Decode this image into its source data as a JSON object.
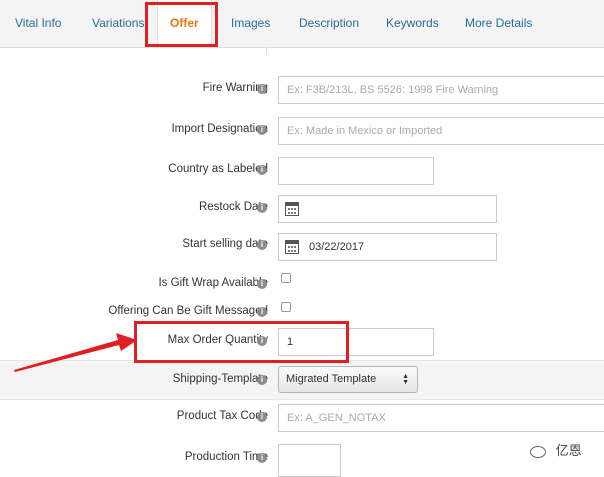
{
  "tabs": [
    {
      "label": "Vital Info"
    },
    {
      "label": "Variations"
    },
    {
      "label": "Offer"
    },
    {
      "label": "Images"
    },
    {
      "label": "Description"
    },
    {
      "label": "Keywords"
    },
    {
      "label": "More Details"
    }
  ],
  "active_tab": "Offer",
  "accent_color": "#e47911",
  "link_color": "#2a6a9e",
  "highlight_color": "#e02020",
  "info_icon_glyph": "i",
  "form": {
    "fire_warning": {
      "label": "Fire Warning",
      "placeholder": "Ex: F3B/213L, BS 5526: 1998 Fire Warning"
    },
    "import_designation": {
      "label": "Import Designation",
      "placeholder": "Ex: Made in Mexico or Imported"
    },
    "country_as_labeled": {
      "label": "Country as Labeled",
      "value": ""
    },
    "restock_date": {
      "label": "Restock Date",
      "value": ""
    },
    "start_selling_date": {
      "label": "Start selling date",
      "value": "03/22/2017"
    },
    "gift_wrap": {
      "label": "Is Gift Wrap Available",
      "checked": false
    },
    "gift_message": {
      "label": "Offering Can Be Gift Messaged",
      "checked": false
    },
    "max_order_quantity": {
      "label": "Max Order Quantity",
      "value": "1"
    },
    "shipping_template": {
      "label": "Shipping-Template",
      "selected": "Migrated Template"
    },
    "product_tax_code": {
      "label": "Product Tax Code",
      "placeholder": "Ex: A_GEN_NOTAX"
    },
    "production_time": {
      "label": "Production Time",
      "value": ""
    }
  },
  "watermark": {
    "text": "亿恩"
  }
}
